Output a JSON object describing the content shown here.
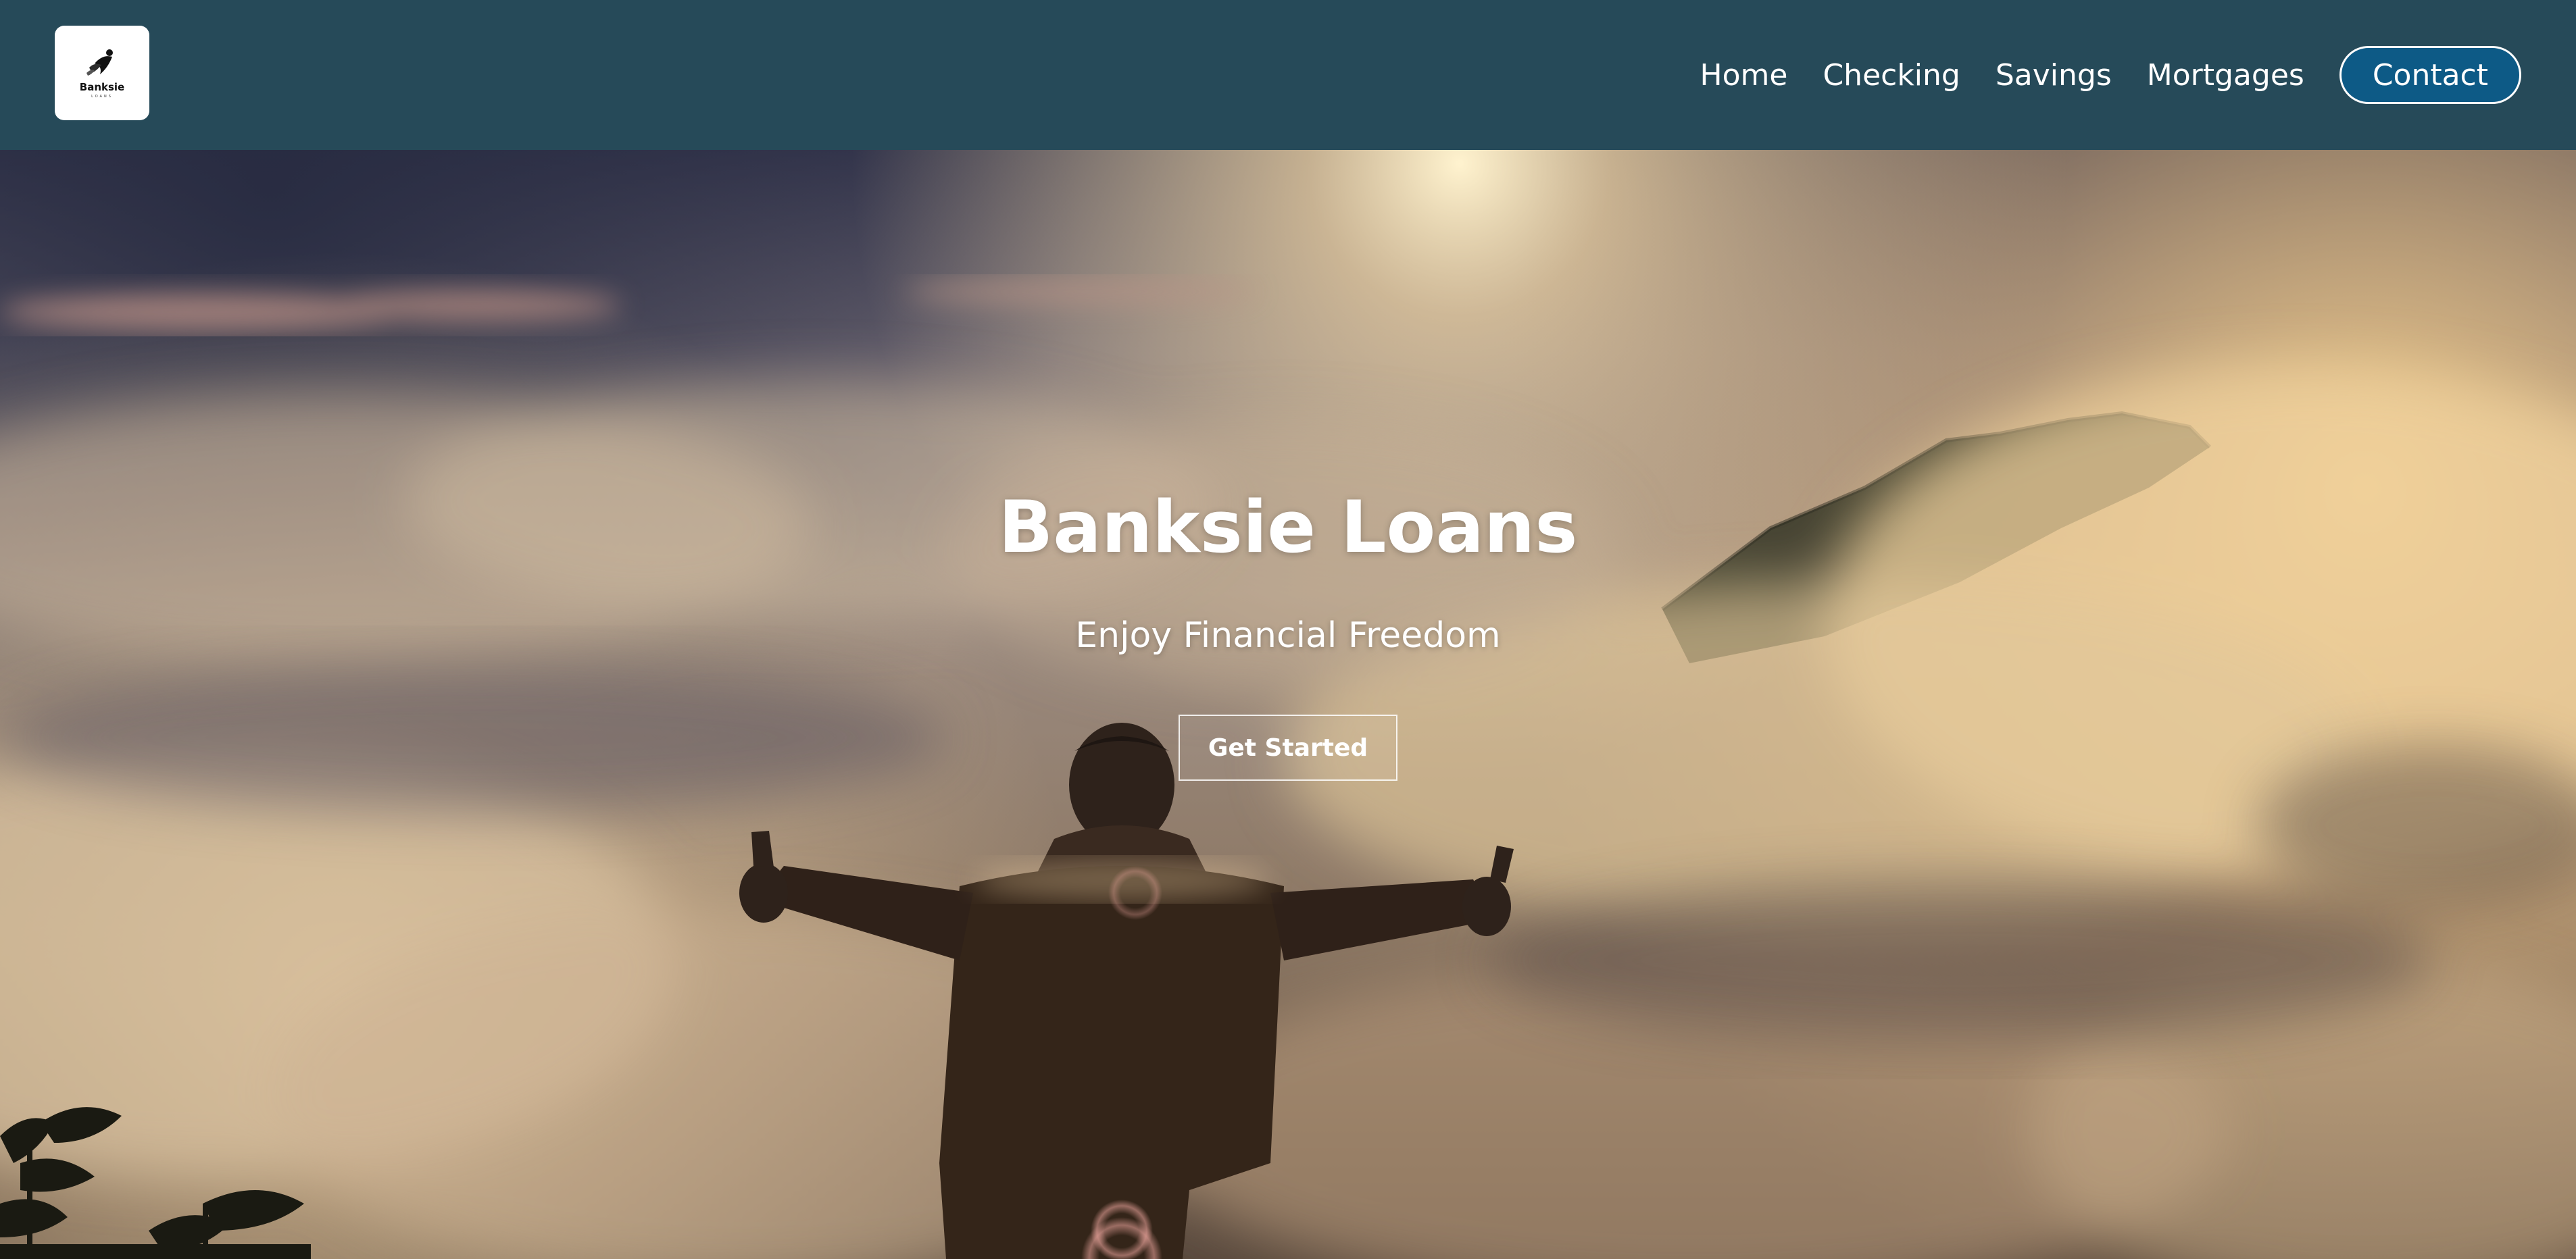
{
  "brand": {
    "logo_word": "Banksie",
    "logo_sub": "LOANS"
  },
  "nav": {
    "items": [
      {
        "label": "Home"
      },
      {
        "label": "Checking"
      },
      {
        "label": "Savings"
      },
      {
        "label": "Mortgages"
      }
    ],
    "contact_label": "Contact"
  },
  "hero": {
    "title": "Banksie Loans",
    "subtitle": "Enjoy Financial Freedom",
    "cta_label": "Get Started"
  },
  "colors": {
    "header_bg": "#264a59",
    "contact_bg": "#0d5a86",
    "text": "#ffffff"
  }
}
